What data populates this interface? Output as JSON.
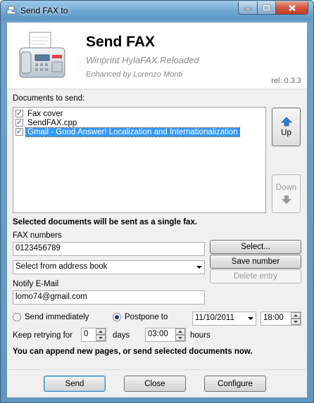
{
  "window": {
    "title": "Send FAX to"
  },
  "header": {
    "title": "Send FAX",
    "subtitle": "Winprint HylaFAX Reloaded",
    "author": "Enhanced by Lorenzo Monti",
    "release": "rel. 0.3.3"
  },
  "documents": {
    "label": "Documents to send:",
    "items": [
      {
        "label": "Fax cover",
        "checked": true,
        "selected": false
      },
      {
        "label": "SendFAX.cpp",
        "checked": true,
        "selected": false
      },
      {
        "label": "Gmail - Good Answer! Localization and Internationalization",
        "checked": true,
        "selected": true
      }
    ],
    "up_label": "Up",
    "down_label": "Down",
    "note": "Selected documents will be sent as a single fax."
  },
  "fax": {
    "numbers_label": "FAX numbers",
    "numbers_value": "0123456789",
    "select_label": "Select...",
    "address_book_value": "Select from address book",
    "save_number_label": "Save number",
    "delete_entry_label": "Delete entry",
    "notify_label": "Notify E-Mail",
    "notify_value": "lomo74@gmail.com"
  },
  "schedule": {
    "send_immediately_label": "Send immediately",
    "postpone_label": "Postpone to",
    "selected": "postpone",
    "date_value": "11/10/2011",
    "time_value": "18:00",
    "retry_label": "Keep retrying for",
    "retry_days_value": "0",
    "days_label": "days",
    "retry_hours_value": "03:00",
    "hours_label": "hours",
    "append_note": "You can append new pages, or send selected documents now."
  },
  "footer": {
    "send_label": "Send",
    "close_label": "Close",
    "configure_label": "Configure"
  },
  "colors": {
    "selection": "#3399ff",
    "arrow_active": "#2a7fd4",
    "arrow_disabled": "#9a9a9a"
  }
}
